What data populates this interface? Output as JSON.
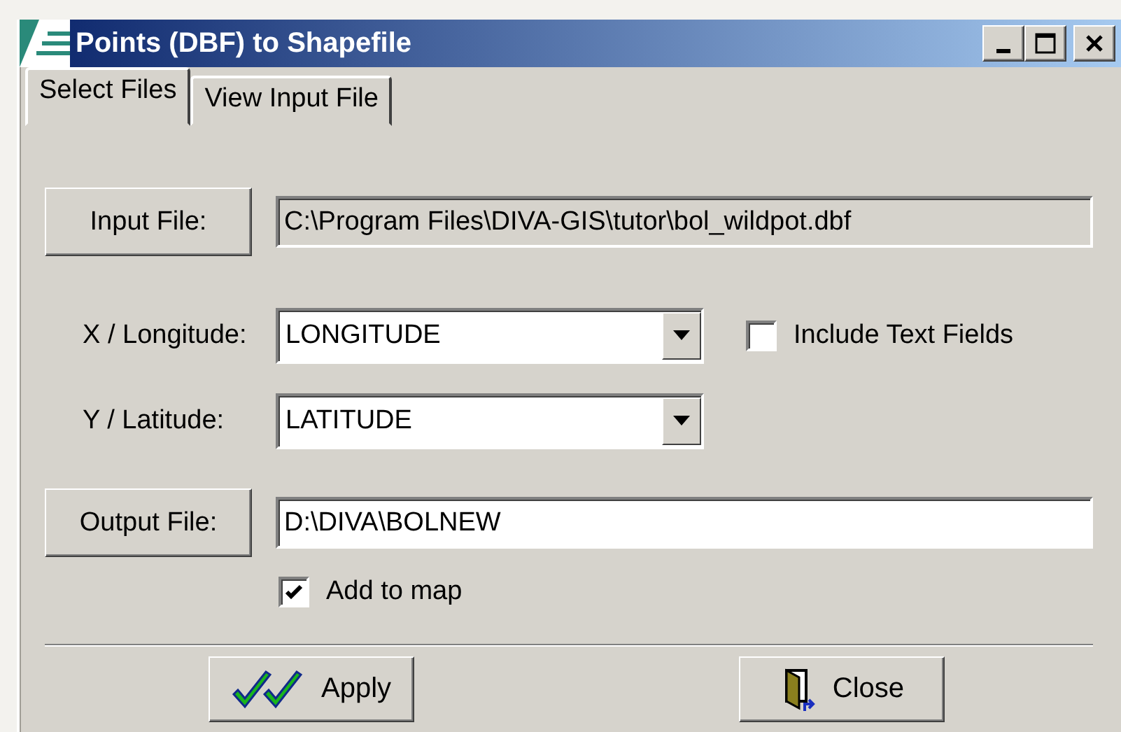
{
  "window": {
    "title": "Points (DBF) to Shapefile"
  },
  "tabs": [
    {
      "label": "Select Files",
      "selected": true
    },
    {
      "label": "View Input File",
      "selected": false
    }
  ],
  "input_file": {
    "button": "Input File:",
    "value": "C:\\Program Files\\DIVA-GIS\\tutor\\bol_wildpot.dbf",
    "disabled": true
  },
  "x_field": {
    "label": "X / Longitude:",
    "value": "LONGITUDE"
  },
  "include_text_fields": {
    "label": "Include Text Fields",
    "checked": false
  },
  "y_field": {
    "label": "Y / Latitude:",
    "value": "LATITUDE"
  },
  "output_file": {
    "button": "Output File:",
    "value": "D:\\DIVA\\BOLNEW",
    "disabled": false
  },
  "add_to_map": {
    "label": "Add to map",
    "checked": true
  },
  "buttons": [
    {
      "label": "Apply",
      "kind": "apply"
    },
    {
      "label": "Close",
      "kind": "close"
    }
  ]
}
